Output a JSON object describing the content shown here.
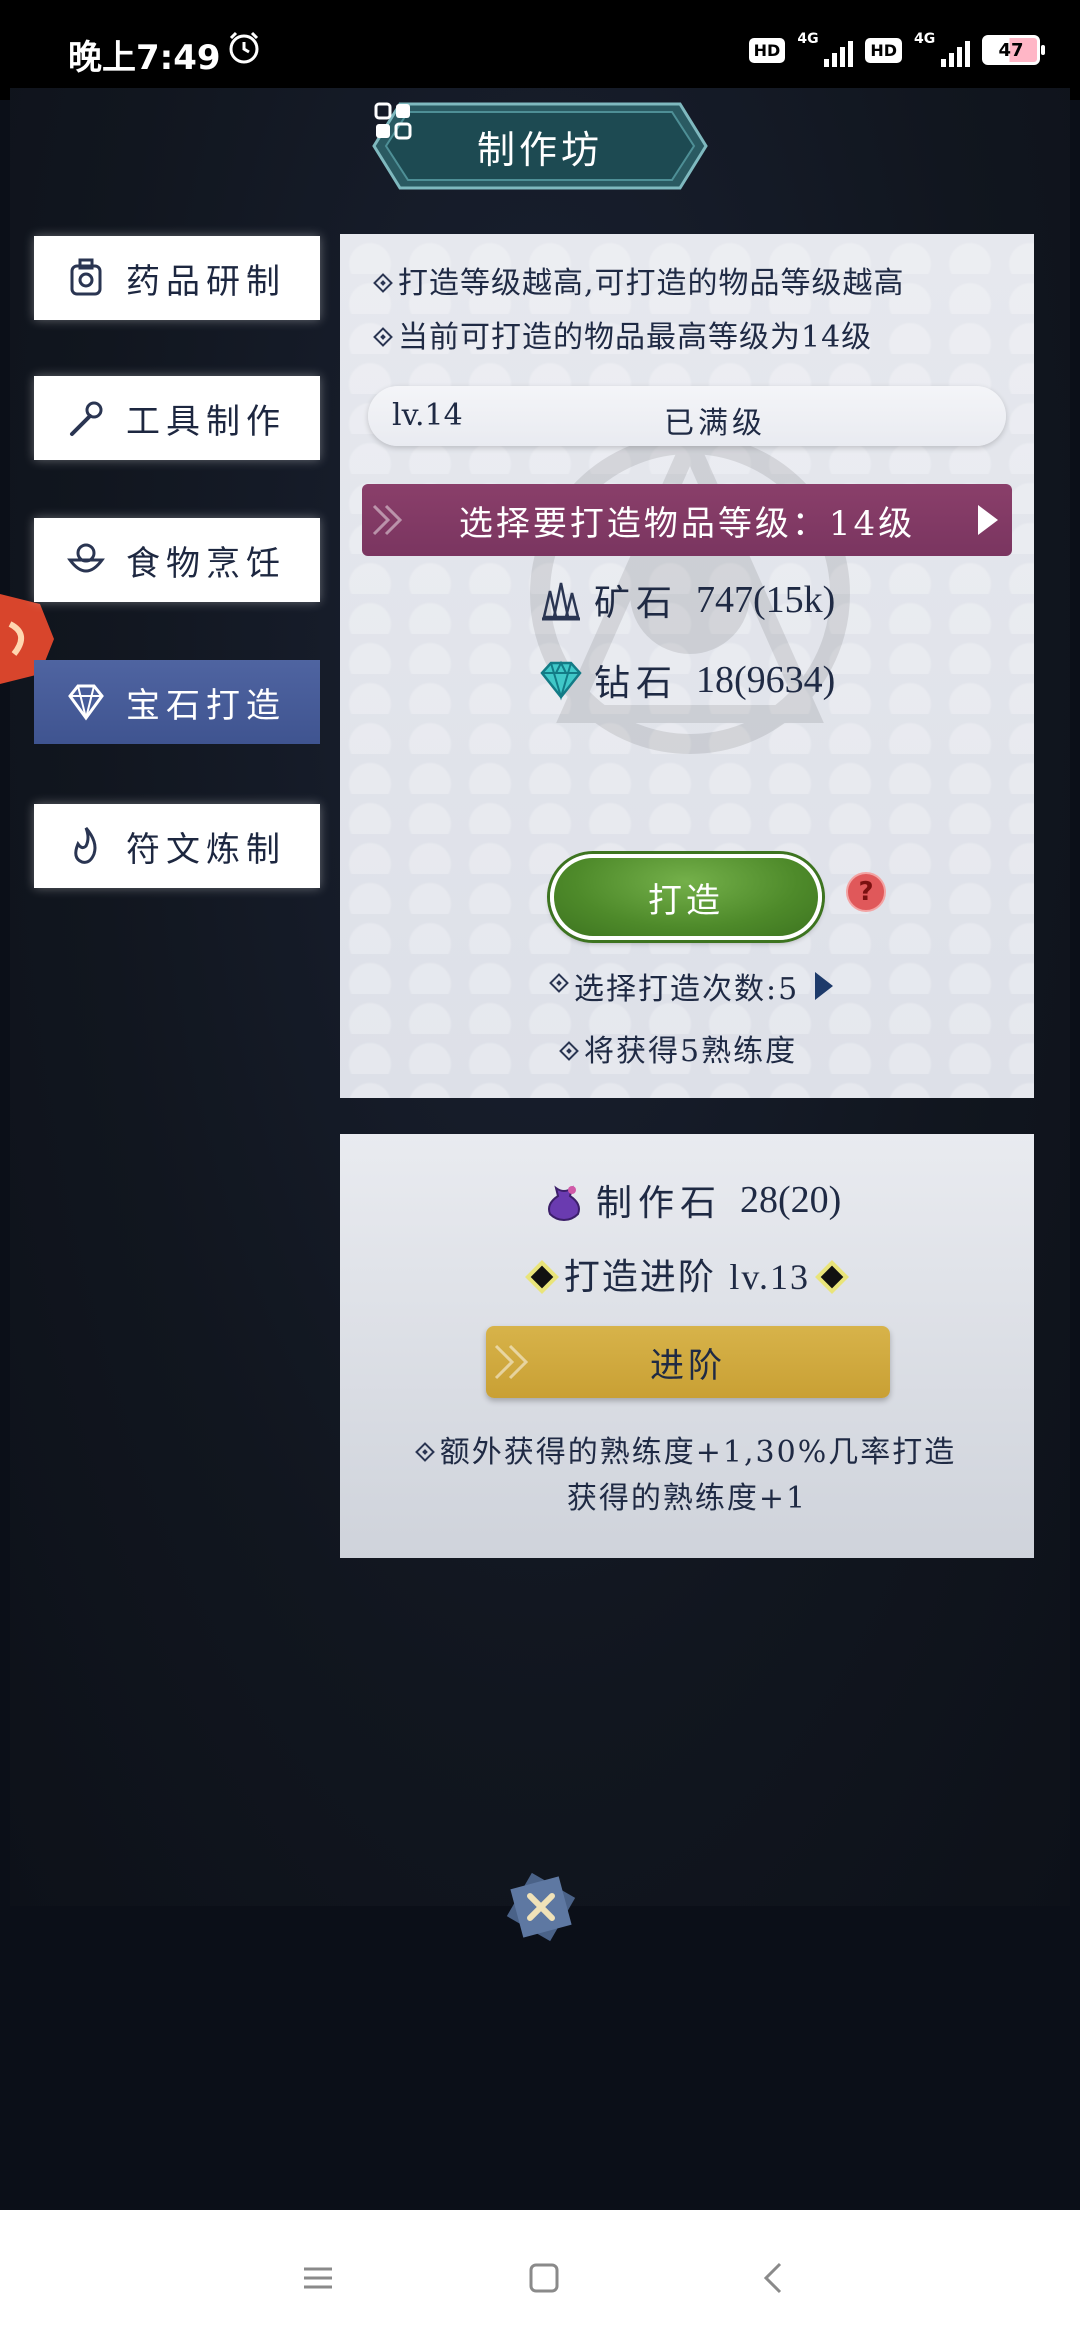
{
  "status_bar": {
    "time": "晚上7:49",
    "hd1": "HD",
    "net1": "4G",
    "hd2": "HD",
    "net2": "4G",
    "battery": "47"
  },
  "title": "制作坊",
  "tabs": [
    {
      "label": "药品研制",
      "icon": "potion-icon",
      "active": false
    },
    {
      "label": "工具制作",
      "icon": "tool-icon",
      "active": false
    },
    {
      "label": "食物烹饪",
      "icon": "food-icon",
      "active": false
    },
    {
      "label": "宝石打造",
      "icon": "gem-icon",
      "active": true
    },
    {
      "label": "符文炼制",
      "icon": "rune-icon",
      "active": false
    }
  ],
  "panel": {
    "hint1": "打造等级越高,可打造的物品等级越高",
    "hint2": "当前可打造的物品最高等级为14级",
    "level": "lv.14",
    "level_status": "已满级",
    "select_label": "选择要打造物品等级：14级",
    "materials": [
      {
        "name": "矿石",
        "value": "747(15k)",
        "icon": "ore-icon"
      },
      {
        "name": "钻石",
        "value": "18(9634)",
        "icon": "diamond-icon"
      }
    ],
    "forge_button": "打造",
    "help": "?",
    "times": "选择打造次数:5",
    "gain": "将获得5熟练度"
  },
  "advance": {
    "stone_name": "制作石",
    "stone_value": "28(20)",
    "level_label": "打造进阶",
    "level_value": "lv.13",
    "button": "进阶",
    "desc_line1": "额外获得的熟练度+1,30%几率打造",
    "desc_line2": "获得的熟练度+1"
  },
  "colors": {
    "active_tab": "#4f64a1",
    "select_bar": "#8a3f6a",
    "forge_green": "#4e8a2a",
    "advance_gold": "#d7b34a"
  }
}
